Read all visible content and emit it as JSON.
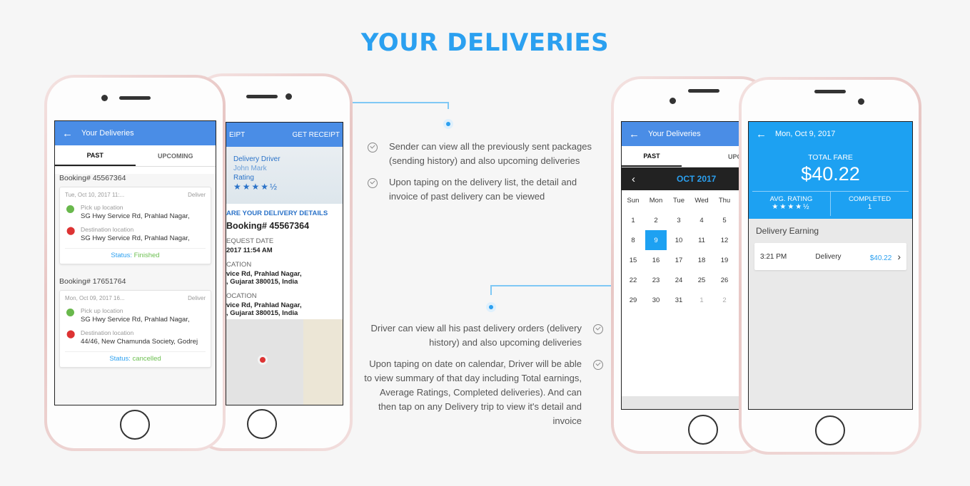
{
  "page": {
    "title": "YOUR DELIVERIES"
  },
  "sender_features": [
    "Sender can view all the previously sent packages (sending history) and also upcoming deliveries",
    "Upon taping on the delivery list, the detail and invoice of past delivery can be viewed"
  ],
  "driver_features": [
    "Driver can view all his past delivery orders (delivery history) and also upcoming deliveries",
    "Upon taping on date on calendar, Driver will be able to view summary of that day including Total earnings, Average Ratings, Completed deliveries). And can then tap on any Delivery trip to view it's detail and invoice"
  ],
  "phone1": {
    "title": "Your Deliveries",
    "tabs": [
      "PAST",
      "UPCOMING"
    ],
    "bookings": [
      {
        "id": "Booking# 45567364",
        "date": "Tue, Oct 10, 2017 11:...",
        "type": "Deliver",
        "pickup_label": "Pick up location",
        "pickup": "SG Hwy Service Rd, Prahlad Nagar,",
        "dest_label": "Destination location",
        "dest": "SG Hwy Service Rd, Prahlad Nagar,",
        "status_label": "Status:",
        "status": "Finished"
      },
      {
        "id": "Booking# 17651764",
        "date": "Mon, Oct 09, 2017 16...",
        "type": "Deliver",
        "pickup_label": "Pick up location",
        "pickup": "SG Hwy Service Rd, Prahlad Nagar,",
        "dest_label": "Destination location",
        "dest": "44/46, New Chamunda Society, Godrej",
        "status_label": "Status:",
        "status": "cancelled"
      }
    ]
  },
  "phone2": {
    "title_partial": "EIPT",
    "get_receipt": "GET RECEIPT",
    "driver_label": "Delivery Driver",
    "driver_name": "John Mark",
    "rating_label": "Rating",
    "share_heading": "ARE YOUR DELIVERY DETAILS",
    "booking": "Booking# 45567364",
    "req_label": "EQUEST DATE",
    "req_value": "2017 11:54 AM",
    "loc1_label": "CATION",
    "loc1_line1": "vice Rd, Prahlad Nagar,",
    "loc1_line2": ", Gujarat 380015, India",
    "loc2_label": "OCATION",
    "loc2_line1": "vice Rd, Prahlad Nagar,",
    "loc2_line2": ", Gujarat 380015, India"
  },
  "phone3": {
    "title": "Your Deliveries",
    "tabs": [
      "PAST",
      "UPC"
    ],
    "month": "OCT 2017",
    "weekdays": [
      "Sun",
      "Mon",
      "Tue",
      "Wed",
      "Thu"
    ],
    "days": [
      [
        "1",
        "2",
        "3",
        "4",
        "5"
      ],
      [
        "8",
        "9",
        "10",
        "11",
        "12"
      ],
      [
        "15",
        "16",
        "17",
        "18",
        "19"
      ],
      [
        "22",
        "23",
        "24",
        "25",
        "26"
      ],
      [
        "29",
        "30",
        "31",
        "1",
        "2"
      ]
    ],
    "selected_day": "9"
  },
  "phone4": {
    "title": "Mon, Oct 9, 2017",
    "total_fare_label": "TOTAL FARE",
    "total_fare": "$40.22",
    "avg_rating_label": "AVG. RATING",
    "completed_label": "COMPLETED",
    "completed": "1",
    "section": "Delivery Earning",
    "trip_time": "3:21 PM",
    "trip_type": "Delivery",
    "trip_amount": "$40.22"
  },
  "colors": {
    "accent": "#2ba0f0",
    "appbar": "#4a8de6",
    "finished": "#6bbf4f"
  }
}
